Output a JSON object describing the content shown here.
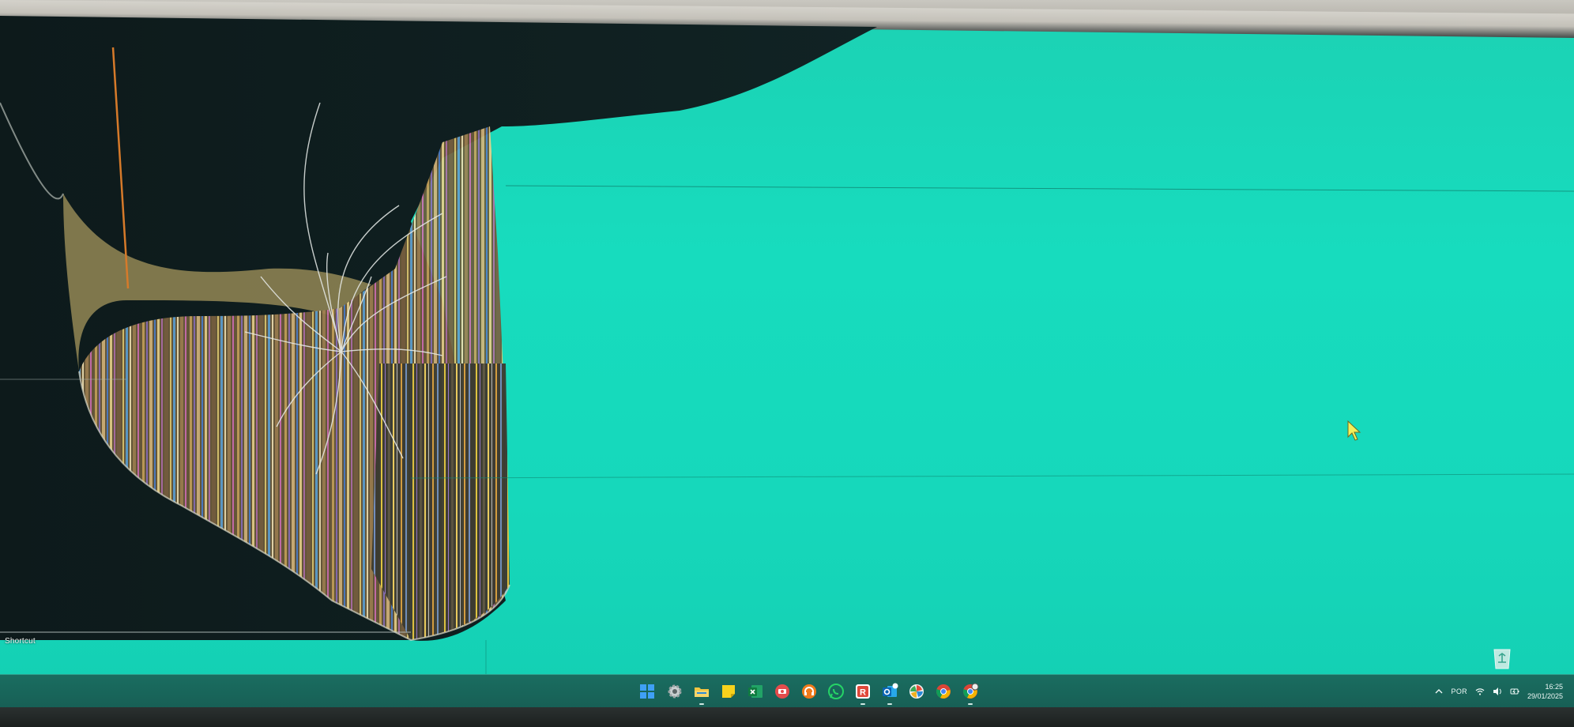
{
  "desktop": {
    "shortcut_label": "Shortcut"
  },
  "taskbar": {
    "apps": [
      {
        "name": "start-button",
        "icon": "windows-logo-icon",
        "color": "#2f8ef5"
      },
      {
        "name": "settings",
        "icon": "gear-icon",
        "color": "#c8cfd0"
      },
      {
        "name": "file-explorer",
        "icon": "folder-icon",
        "color": "#f4c542"
      },
      {
        "name": "sticky-notes",
        "icon": "sticky-note-icon",
        "color": "#f7d21c"
      },
      {
        "name": "excel",
        "icon": "excel-icon",
        "color": "#1e7a45"
      },
      {
        "name": "app-red",
        "icon": "red-circle-app-icon",
        "color": "#e34c4c"
      },
      {
        "name": "app-orange",
        "icon": "orange-headphones-icon",
        "color": "#f07a1a"
      },
      {
        "name": "whatsapp",
        "icon": "whatsapp-icon",
        "color": "#25d366"
      },
      {
        "name": "app-r",
        "icon": "r-letter-app-icon",
        "color": "#e0483a"
      },
      {
        "name": "outlook",
        "icon": "outlook-icon",
        "color": "#1a73c9"
      },
      {
        "name": "app-pinwheel",
        "icon": "pinwheel-icon",
        "color": "#f0f0f0"
      },
      {
        "name": "chrome",
        "icon": "chrome-icon",
        "color": "#e6b326"
      },
      {
        "name": "chrome-profile",
        "icon": "chrome-profile-icon",
        "color": "#e6b326"
      }
    ],
    "tray": {
      "language": "POR",
      "time": "16:25",
      "date": "29/01/2025"
    }
  }
}
